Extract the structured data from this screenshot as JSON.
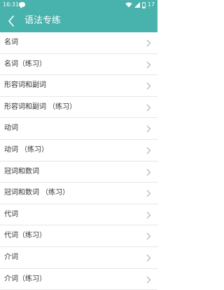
{
  "status_bar": {
    "time": "16:31",
    "battery": "17",
    "icons": [
      "chat-bubble-icon",
      "wifi-icon",
      "signal-icon",
      "battery-icon"
    ]
  },
  "app_bar": {
    "title": "语法专练",
    "back_icon": "chevron-left-icon"
  },
  "colors": {
    "accent": "#48b2ad",
    "text": "#333333",
    "divider": "#e6e6e6",
    "chevron": "#aaaaaa"
  },
  "list": {
    "items": [
      {
        "label": "名词"
      },
      {
        "label": "名词（练习）"
      },
      {
        "label": "形容词和副词"
      },
      {
        "label": "形容词和副词 （练习）"
      },
      {
        "label": "动词"
      },
      {
        "label": "动词 （练习）"
      },
      {
        "label": "冠词和数词"
      },
      {
        "label": "冠词和数词 （练习）"
      },
      {
        "label": "代词"
      },
      {
        "label": "代词（练习）"
      },
      {
        "label": "介词"
      },
      {
        "label": "介词（练习）"
      }
    ]
  }
}
